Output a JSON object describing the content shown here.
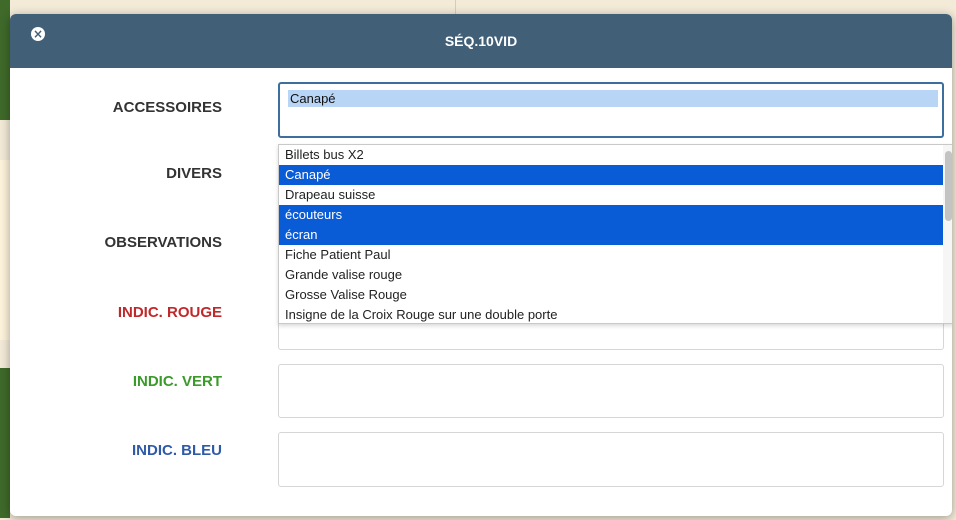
{
  "dialog": {
    "title": "SÉQ.10VID",
    "close_icon": "close-icon"
  },
  "fields": {
    "accessoires": {
      "label": "ACCESSOIRES",
      "value": "Canapé"
    },
    "divers": {
      "label": "DIVERS"
    },
    "observations": {
      "label": "OBSERVATIONS"
    },
    "indic_rouge": {
      "label": "INDIC. ROUGE",
      "color": "#c0282a"
    },
    "indic_vert": {
      "label": "INDIC. VERT",
      "color": "#3a9a2a"
    },
    "indic_bleu": {
      "label": "INDIC. BLEU",
      "color": "#2f5aa8"
    }
  },
  "dropdown": {
    "options": [
      {
        "label": "Billets bus X2",
        "selected": false
      },
      {
        "label": "Canapé",
        "selected": true
      },
      {
        "label": "Drapeau suisse",
        "selected": false
      },
      {
        "label": "écouteurs",
        "selected": true
      },
      {
        "label": "écran",
        "selected": true
      },
      {
        "label": "Fiche Patient Paul",
        "selected": false
      },
      {
        "label": "Grande valise rouge",
        "selected": false
      },
      {
        "label": "Grosse Valise Rouge",
        "selected": false
      },
      {
        "label": "Insigne de la Croix Rouge sur une double porte",
        "selected": false
      }
    ],
    "selected_color": "#0a5bd6"
  },
  "colors": {
    "header": "#425f78",
    "focus_border": "#3c6f9e",
    "chip": "#b9d5f5"
  }
}
